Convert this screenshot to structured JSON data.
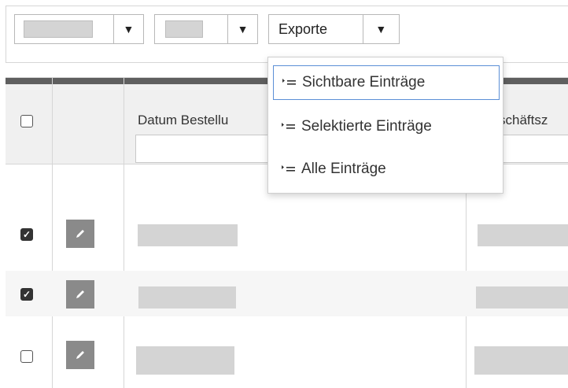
{
  "toolbar": {
    "exporte_label": "Exporte",
    "caret_icon": "caret-down-icon"
  },
  "grid": {
    "columns": {
      "datum_label": "Datum Bestellu",
      "geschaefts_label": "schäftsz"
    },
    "rows": [
      {
        "checked": true
      },
      {
        "checked": true
      },
      {
        "checked": false
      }
    ]
  },
  "export_menu": {
    "items": [
      {
        "label": "Sichtbare Einträge",
        "icon": "list-arrow-icon",
        "active": true
      },
      {
        "label": "Selektierte Einträge",
        "icon": "list-arrow-icon",
        "active": false
      },
      {
        "label": "Alle Einträge",
        "icon": "list-arrow-icon",
        "active": false
      }
    ]
  },
  "colors": {
    "header_strip": "#5f5f5f",
    "edit_button": "#8a8a8a",
    "active_item_border": "#5b8fd6",
    "placeholder": "#d4d4d4"
  }
}
